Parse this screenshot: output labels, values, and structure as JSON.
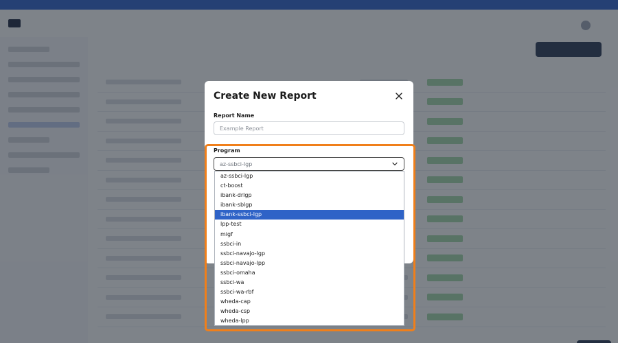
{
  "modal": {
    "title": "Create New Report",
    "report_name_label": "Report Name",
    "report_name_placeholder": "Example Report",
    "program_label": "Program",
    "program_selected": "az-ssbci-lgp"
  },
  "program_options": [
    {
      "label": "az-ssbci-lgp",
      "highlighted": false
    },
    {
      "label": "ct-boost",
      "highlighted": false
    },
    {
      "label": "ibank-drlgp",
      "highlighted": false
    },
    {
      "label": "ibank-sblgp",
      "highlighted": false
    },
    {
      "label": "ibank-ssbci-lgp",
      "highlighted": true
    },
    {
      "label": "lpp-test",
      "highlighted": false
    },
    {
      "label": "migf",
      "highlighted": false
    },
    {
      "label": "ssbci-in",
      "highlighted": false
    },
    {
      "label": "ssbci-navajo-lgp",
      "highlighted": false
    },
    {
      "label": "ssbci-navajo-lpp",
      "highlighted": false
    },
    {
      "label": "ssbci-omaha",
      "highlighted": false
    },
    {
      "label": "ssbci-wa",
      "highlighted": false
    },
    {
      "label": "ssbci-wa-rbf",
      "highlighted": false
    },
    {
      "label": "wheda-cap",
      "highlighted": false
    },
    {
      "label": "wheda-csp",
      "highlighted": false
    },
    {
      "label": "wheda-lpp",
      "highlighted": false
    }
  ],
  "colors": {
    "accent": "#2f63c7",
    "highlight_outline": "#f07f1a",
    "overlay": "#1e2530"
  },
  "icons": {
    "close": "close-icon",
    "chevron": "chevron-down-icon"
  }
}
